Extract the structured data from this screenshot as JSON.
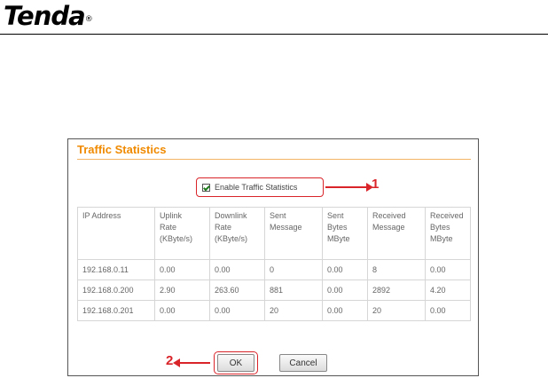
{
  "brand": {
    "name": "Tenda",
    "mark": "®"
  },
  "panel": {
    "title": "Traffic Statistics",
    "enable_label": "Enable Traffic Statistics",
    "enable_checked": true
  },
  "annotations": {
    "one": "1",
    "two": "2"
  },
  "table": {
    "headers": [
      [
        "IP Address"
      ],
      [
        "Uplink",
        "Rate",
        "(KByte/s)"
      ],
      [
        "Downlink",
        "Rate",
        "(KByte/s)"
      ],
      [
        "Sent",
        "Message"
      ],
      [
        "Sent",
        "Bytes",
        "MByte"
      ],
      [
        "Received",
        "Message"
      ],
      [
        "Received",
        "Bytes",
        "MByte"
      ]
    ],
    "rows": [
      [
        "192.168.0.11",
        "0.00",
        "0.00",
        "0",
        "0.00",
        "8",
        "0.00"
      ],
      [
        "192.168.0.200",
        "2.90",
        "263.60",
        "881",
        "0.00",
        "2892",
        "4.20"
      ],
      [
        "192.168.0.201",
        "0.00",
        "0.00",
        "20",
        "0.00",
        "20",
        "0.00"
      ]
    ]
  },
  "buttons": {
    "ok": "OK",
    "cancel": "Cancel"
  },
  "colors": {
    "title": "#f08a00",
    "annotation": "#d9242a"
  }
}
